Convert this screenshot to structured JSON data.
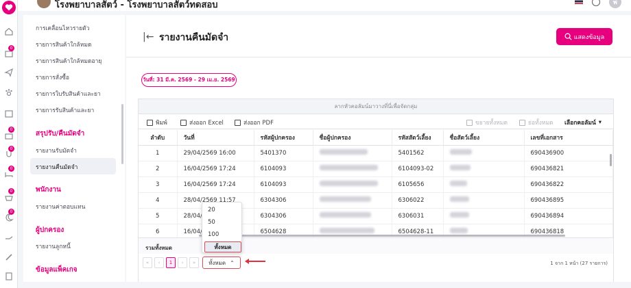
{
  "app": {
    "title": "โรงพยาบาลสัตว์ - โรงพยาบาลสัตว์ทดสอบ",
    "user_initial": "พ"
  },
  "rail": {
    "badges": [
      "0",
      "0",
      "0",
      "0",
      "0",
      "0"
    ]
  },
  "sidebar": {
    "items_top": [
      "การเคลื่อนไหวรายตัว",
      "รายการสินค้าใกล้หมด",
      "รายการสินค้าใกล้หมดอายุ",
      "รายการสั่งซื้อ",
      "รายการใบรับสินค้าและยา",
      "รายการรับสินค้าและยา"
    ],
    "section_refund": "สรุปรับ/คืนมัดจำ",
    "refund_items": [
      "รายงานรับมัดจำ",
      "รายงานคืนมัดจำ"
    ],
    "section_staff": "พนักงาน",
    "staff_items": [
      "รายงานค่าตอบแทน"
    ],
    "section_owner": "ผู้ปกครอง",
    "owner_items": [
      "รายงานลูกหนี้"
    ],
    "section_package": "ข้อมูลแพ็คเกจ"
  },
  "page": {
    "title": "รายงานคืนมัดจำ",
    "show_button": "แสดงข้อมูล",
    "date_range": "วันที่: 31 มี.ค. 2569 - 29 เม.ย. 2569"
  },
  "grid": {
    "group_hint": "ลากหัวคอลัมน์มาวางที่นี่เพื่อจัดกลุ่ม",
    "toolbar": {
      "print": "พิมพ์",
      "excel": "ส่งออก Excel",
      "pdf": "ส่งออก PDF",
      "expand": "ขยายทั้งหมด",
      "collapse": "ย่อทั้งหมด",
      "columns": "เลือกคอลัมน์"
    },
    "columns": [
      "ลำดับ",
      "วันที่",
      "รหัสผู้ปกครอง",
      "ชื่อผู้ปกครอง",
      "รหัสสัตว์เลี้ยง",
      "ชื่อสัตว์เลี้ยง",
      "เลขที่เอกสาร"
    ],
    "rows": [
      [
        "1",
        "29/04/2569 16:00",
        "5401370",
        "5401562",
        "690436900"
      ],
      [
        "2",
        "16/04/2569 17:24",
        "6104093",
        "6104093-02",
        "690436821"
      ],
      [
        "3",
        "16/04/2569 17:24",
        "6104093",
        "6105656",
        "690436822"
      ],
      [
        "4",
        "28/04/2569 11:57",
        "6304306",
        "6306022",
        "690436895"
      ],
      [
        "5",
        "28/04/",
        "6304306",
        "6306031",
        "690436894"
      ],
      [
        "6",
        "16/04/",
        "6504628",
        "6504628-11",
        "690436818"
      ]
    ],
    "total_label": "รวมทั้งหมด",
    "pager": {
      "first": "«",
      "prev": "‹",
      "page": "1",
      "next": "›",
      "last": "»",
      "size": "ทั้งหมด",
      "info": "1 จาก 1 หน้า (27 รายการ)"
    },
    "size_options": [
      "20",
      "50",
      "100",
      "ทั้งหมด"
    ]
  },
  "colors": {
    "accent": "#e6007e",
    "highlight": "#d94a55"
  }
}
